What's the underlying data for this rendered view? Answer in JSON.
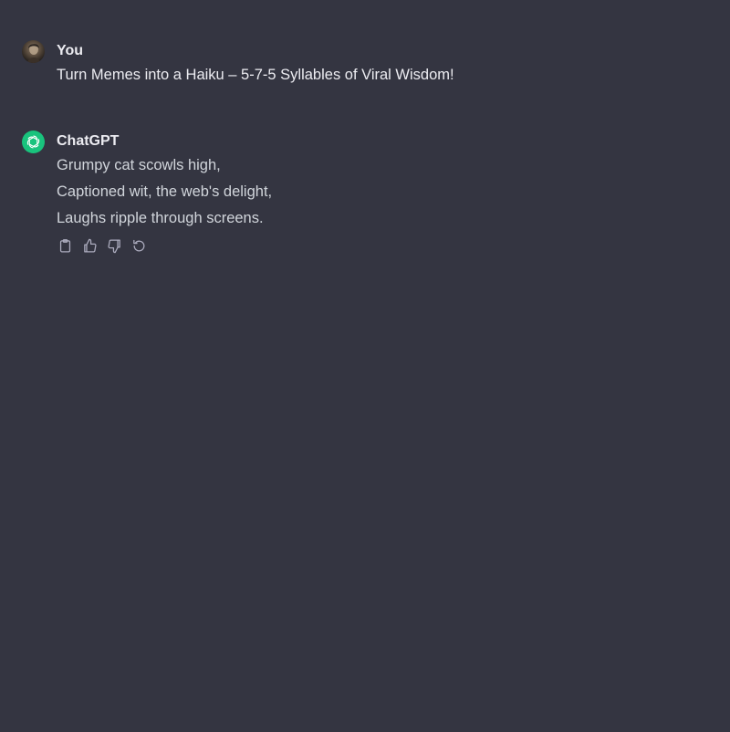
{
  "conversation": {
    "user": {
      "author": "You",
      "avatar": "user-photo-avatar",
      "text": "Turn Memes into a Haiku – 5-7-5 Syllables of Viral Wisdom!"
    },
    "assistant": {
      "author": "ChatGPT",
      "avatar": "openai-logo-icon",
      "lines": [
        "Grumpy cat scowls high,",
        "Captioned wit, the web's delight,",
        "Laughs ripple through screens."
      ],
      "actions": [
        {
          "icon": "clipboard-icon",
          "label": "Copy"
        },
        {
          "icon": "thumbs-up-icon",
          "label": "Good response"
        },
        {
          "icon": "thumbs-down-icon",
          "label": "Bad response"
        },
        {
          "icon": "regenerate-icon",
          "label": "Regenerate"
        }
      ]
    }
  },
  "colors": {
    "background": "#343541",
    "text": "#ececf1",
    "muted_icon": "#acacbe",
    "gpt_avatar": "#19c37d"
  }
}
